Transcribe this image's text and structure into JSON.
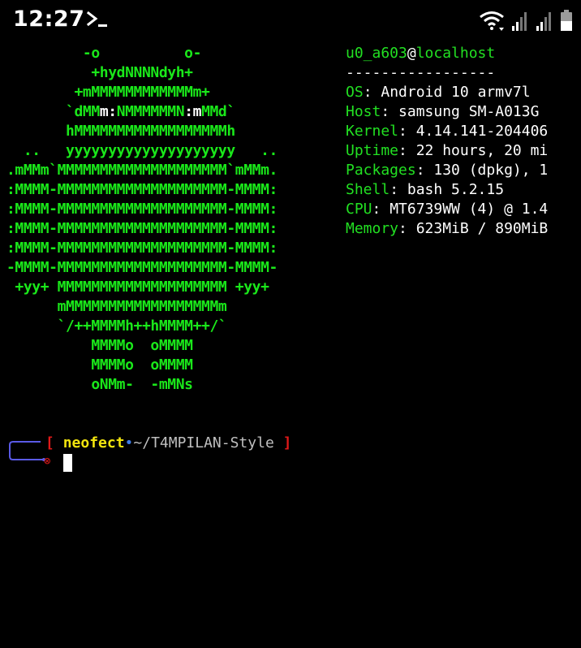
{
  "status_bar": {
    "time": "12:27",
    "app_icon": "terminal-prompt-icon",
    "icons": [
      "wifi-icon",
      "signal-icon",
      "signal-icon",
      "battery-icon"
    ]
  },
  "logo": {
    "lines": [
      "    -o          o-",
      "     +hydNNNNdyh+",
      "   +mMMMMMMMMMMMMm+",
      "  `dMM​m:NMMMMMMN:mMMd`",
      "  hMMMMMMMMMMMMMMMMMMh",
      ".. yyyyyyyyyyyyyyyyyyyy .."
    ],
    "rows": [
      {
        "parts": [
          {
            "t": "         -o          o-",
            "c": "g"
          }
        ]
      },
      {
        "parts": [
          {
            "t": "          +hydNNNNdyh+",
            "c": "g"
          }
        ]
      },
      {
        "parts": [
          {
            "t": "        +mMMMMMMMMMMMMm+",
            "c": "g"
          }
        ]
      },
      {
        "parts": [
          {
            "t": "       `dMM",
            "c": "g"
          },
          {
            "t": "m:",
            "c": "w"
          },
          {
            "t": "NMMMMMMN",
            "c": "g"
          },
          {
            "t": ":m",
            "c": "w"
          },
          {
            "t": "MMd`",
            "c": "g"
          }
        ]
      },
      {
        "parts": [
          {
            "t": "       hMMMMMMMMMMMMMMMMMMh",
            "c": "g"
          }
        ]
      },
      {
        "parts": [
          {
            "t": "  ..   yyyyyyyyyyyyyyyyyyyy   ..",
            "c": "g"
          }
        ]
      },
      {
        "parts": [
          {
            "t": ".mMMm`MMMMMMMMMMMMMMMMMMMM`mMMm.",
            "c": "g"
          }
        ]
      },
      {
        "parts": [
          {
            "t": ":MMMM-MMMMMMMMMMMMMMMMMMMM-MMMM:",
            "c": "g"
          }
        ]
      },
      {
        "parts": [
          {
            "t": ":MMMM-MMMMMMMMMMMMMMMMMMMM-MMMM:",
            "c": "g"
          }
        ]
      },
      {
        "parts": [
          {
            "t": ":MMMM-MMMMMMMMMMMMMMMMMMMM-MMMM:",
            "c": "g"
          }
        ]
      },
      {
        "parts": [
          {
            "t": ":MMMM-MMMMMMMMMMMMMMMMMMMM-MMMM:",
            "c": "g"
          }
        ]
      },
      {
        "parts": [
          {
            "t": "-MMMM-MMMMMMMMMMMMMMMMMMMM-MMMM-",
            "c": "g"
          }
        ]
      },
      {
        "parts": [
          {
            "t": " +yy+ MMMMMMMMMMMMMMMMMMMM +yy+",
            "c": "g"
          }
        ]
      },
      {
        "parts": [
          {
            "t": "      mMMMMMMMMMMMMMMMMMMm",
            "c": "g"
          }
        ]
      },
      {
        "parts": [
          {
            "t": "      `/++MMMMh++hMMMM++/`",
            "c": "g"
          }
        ]
      },
      {
        "parts": [
          {
            "t": "          MMMMo  oMMMM",
            "c": "g"
          }
        ]
      },
      {
        "parts": [
          {
            "t": "          MMMMo  oMMMM",
            "c": "g"
          }
        ]
      },
      {
        "parts": [
          {
            "t": "          oNMm-  -mMNs",
            "c": "g"
          }
        ]
      }
    ]
  },
  "info": {
    "user": "u0_a603",
    "at": "@",
    "host": "localhost",
    "separator": "-----------------",
    "fields": [
      {
        "key": "OS",
        "value": ": Android 10 armv7l"
      },
      {
        "key": "Host",
        "value": ": samsung SM-A013G"
      },
      {
        "key": "Kernel",
        "value": ": 4.14.141-204406"
      },
      {
        "key": "Uptime",
        "value": ": 22 hours, 20 mi"
      },
      {
        "key": "Packages",
        "value": ": 130 (dpkg), 1"
      },
      {
        "key": "Shell",
        "value": ": bash 5.2.15"
      },
      {
        "key": "CPU",
        "value": ": MT6739WW (4) @ 1.4"
      },
      {
        "key": "Memory",
        "value": ": 623MiB / 890MiB"
      }
    ]
  },
  "prompt": {
    "open_bracket": "[",
    "user": "neofect",
    "dot": "•",
    "path": "~/T4MPILAN-Style",
    "close_bracket": "]",
    "marker": "⊗"
  },
  "colors": {
    "background": "#000000",
    "ascii_green": "#1ae81a",
    "info_green": "#22e022",
    "prompt_bracket": "#e01919",
    "prompt_user": "#f2e40e",
    "prompt_dot": "#3e7de8",
    "prompt_path": "#bfbfbf",
    "connector": "#5a5ae6"
  }
}
